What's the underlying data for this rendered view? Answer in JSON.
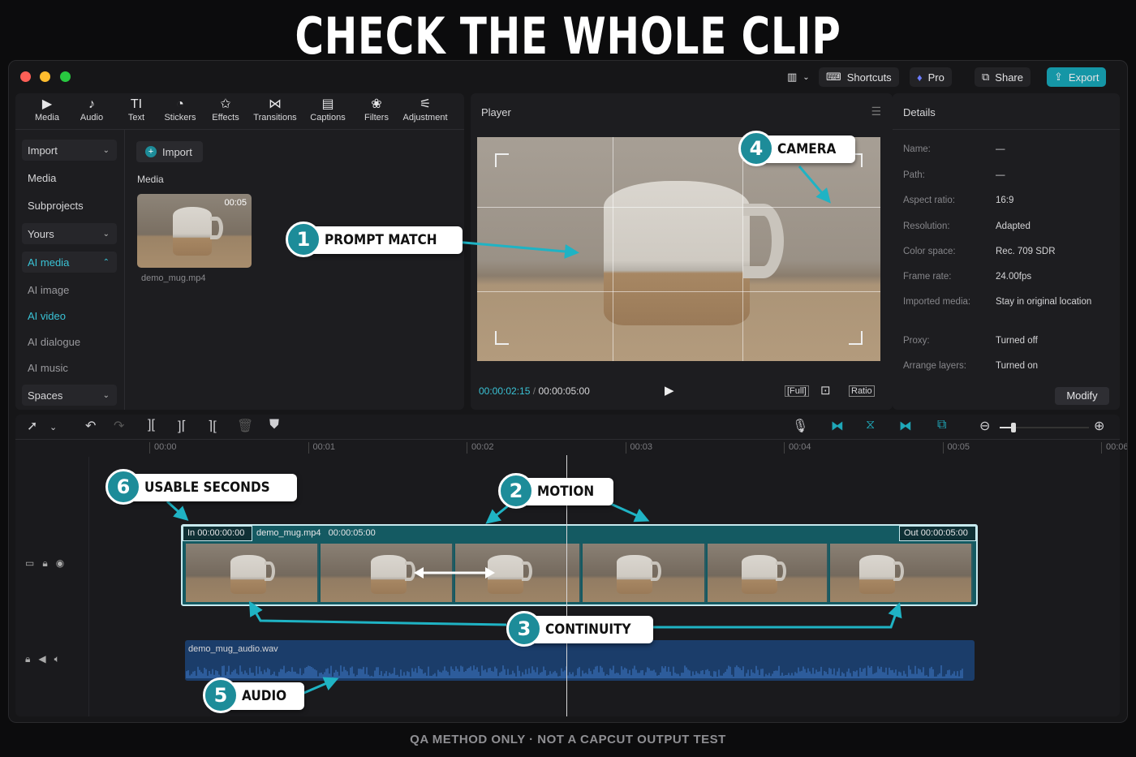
{
  "headline": "CHECK THE WHOLE CLIP",
  "footer": "QA METHOD ONLY  ·  NOT A CAPCUT OUTPUT TEST",
  "titlebar": {
    "shortcuts": "Shortcuts",
    "pro": "Pro",
    "share": "Share",
    "export": "Export",
    "traffic_colors": [
      "#ff5f57",
      "#febc2e",
      "#28c840"
    ]
  },
  "toolbar": [
    {
      "label": "Media",
      "icon": "media-icon",
      "glyph": "▶"
    },
    {
      "label": "Audio",
      "icon": "audio-icon",
      "glyph": "♪"
    },
    {
      "label": "Text",
      "icon": "text-icon",
      "glyph": "TI"
    },
    {
      "label": "Stickers",
      "icon": "stickers-icon",
      "glyph": "◔"
    },
    {
      "label": "Effects",
      "icon": "effects-icon",
      "glyph": "✩"
    },
    {
      "label": "Transitions",
      "icon": "transitions-icon",
      "glyph": "⋈"
    },
    {
      "label": "Captions",
      "icon": "captions-icon",
      "glyph": "▤"
    },
    {
      "label": "Filters",
      "icon": "filters-icon",
      "glyph": "❀"
    },
    {
      "label": "Adjustment",
      "icon": "adjustment-icon",
      "glyph": "⚟"
    }
  ],
  "sidebar": {
    "import": "Import",
    "media": "Media",
    "subprojects": "Subprojects",
    "yours": "Yours",
    "ai_media": "AI media",
    "ai_image": "AI image",
    "ai_video": "AI video",
    "ai_dialogue": "AI dialogue",
    "ai_music": "AI music",
    "spaces": "Spaces"
  },
  "media_panel": {
    "import_button": "Import",
    "section": "Media",
    "clip_name": "demo_mug.mp4",
    "clip_duration": "00:05"
  },
  "player": {
    "title": "Player",
    "current_time": "00:00:02:15",
    "separator": "/",
    "total_time": "00:00:05:00",
    "full": "[Full]",
    "ratio": "Ratio"
  },
  "details": {
    "title": "Details",
    "rows": [
      {
        "label": "Name:",
        "value": "—"
      },
      {
        "label": "Path:",
        "value": "—"
      },
      {
        "label": "Aspect ratio:",
        "value": "16:9"
      },
      {
        "label": "Resolution:",
        "value": "Adapted"
      },
      {
        "label": "Color space:",
        "value": "Rec. 709 SDR"
      },
      {
        "label": "Frame rate:",
        "value": "24.00fps"
      },
      {
        "label": "Imported media:",
        "value": "Stay in original location"
      },
      {
        "label": "Proxy:",
        "value": "Turned off"
      },
      {
        "label": "Arrange layers:",
        "value": "Turned on"
      }
    ],
    "modify": "Modify"
  },
  "timeline": {
    "ruler": [
      "00:00",
      "00:01",
      "00:02",
      "00:03",
      "00:04",
      "00:05",
      "00:06"
    ],
    "clip_in": "In  00:00:00:00",
    "clip_name": "demo_mug.mp4",
    "clip_length": "00:00:05:00",
    "clip_out": "Out  00:00:05:00",
    "audio_name": "demo_mug_audio.wav",
    "zoom_level": 0.15,
    "playhead_time": "00:00:02:15"
  },
  "callouts": [
    {
      "num": "1",
      "label": "PROMPT MATCH"
    },
    {
      "num": "2",
      "label": "MOTION"
    },
    {
      "num": "3",
      "label": "CONTINUITY"
    },
    {
      "num": "4",
      "label": "CAMERA"
    },
    {
      "num": "5",
      "label": "AUDIO"
    },
    {
      "num": "6",
      "label": "USABLE SECONDS"
    }
  ],
  "colors": {
    "accent": "#1d8c99",
    "export_bg": "#1596a6",
    "ai_active": "#3ac3d6",
    "audio_track": "#1b3d6a"
  }
}
